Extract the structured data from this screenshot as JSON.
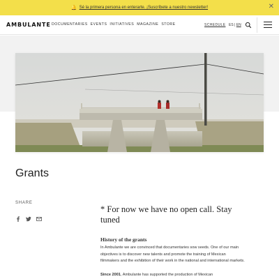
{
  "announcement": {
    "text": "Sé la primera persona en enterarte. ¡Suscríbete a nuestro newsletter!",
    "close_glyph": "✕"
  },
  "header": {
    "logo": "AMBULANTE",
    "nav": [
      "DOCUMENTARIES",
      "EVENTS",
      "INITIATIVES",
      "MAGAZINE",
      "STORE"
    ],
    "schedule": "SCHEDULE",
    "lang_es": "ES",
    "lang_sep": "|",
    "lang_en": "EN"
  },
  "page": {
    "title": "Grants"
  },
  "share": {
    "label": "SHARE",
    "icons": [
      "facebook-icon",
      "twitter-icon",
      "email-icon"
    ]
  },
  "content": {
    "notice": "* For now we have no open call. Stay tuned",
    "history_heading": "History of the grants",
    "paragraph_1": "In Ambulante we are convinced that documentaries sow seeds. One of our main objectives is to discover new talents and promote the training of Mexican filmmakers and the exhibition of their work in the national and international markets.",
    "paragraph_2_bold": "Since 2001",
    "paragraph_2_rest": ", Ambulante has supported the production of Mexican"
  },
  "colors": {
    "announcement_bg": "#f3df4a",
    "band_bg": "#f2f2f2"
  }
}
